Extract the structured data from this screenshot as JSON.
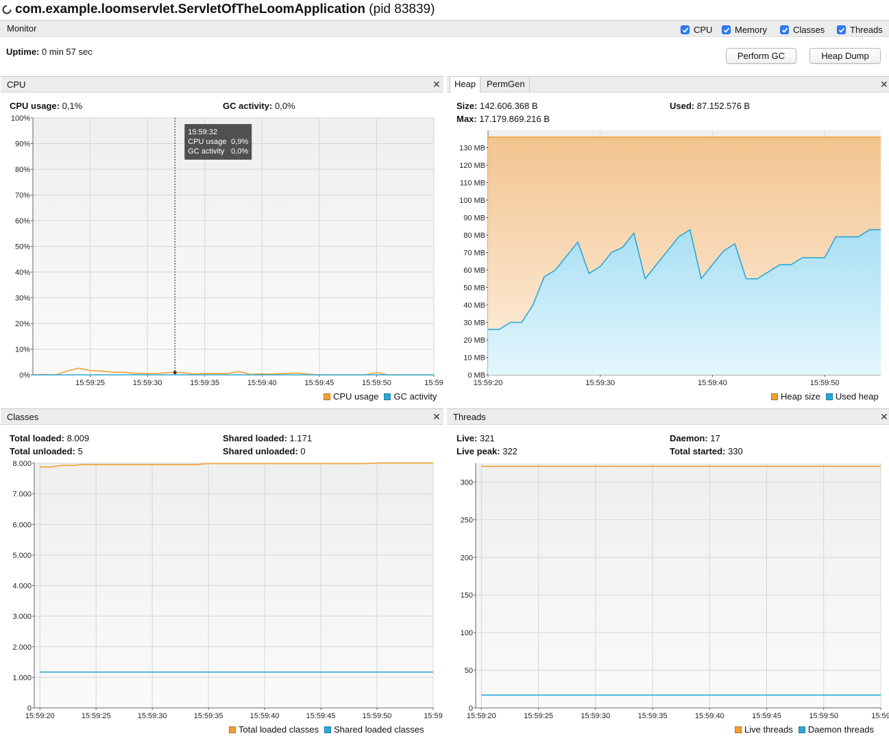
{
  "window": {
    "app_name": "com.example.loomservlet.ServletOfTheLoomApplication",
    "pid_text": "(pid 83839)"
  },
  "monitor": {
    "label": "Monitor",
    "checkboxes": [
      {
        "label": "CPU",
        "checked": true
      },
      {
        "label": "Memory",
        "checked": true
      },
      {
        "label": "Classes",
        "checked": true
      },
      {
        "label": "Threads",
        "checked": true
      }
    ],
    "uptime_label": "Uptime:",
    "uptime_value": "0 min 57 sec",
    "perform_gc": "Perform GC",
    "heap_dump": "Heap Dump"
  },
  "cpu": {
    "title": "CPU",
    "usage_label": "CPU usage:",
    "usage_value": "0,1%",
    "gc_label": "GC activity:",
    "gc_value": "0,0%",
    "tooltip": {
      "time": "15:59:32",
      "cpu_label": "CPU usage",
      "cpu_value": "0,9%",
      "gc_label": "GC activity",
      "gc_value": "0,0%"
    },
    "legend": [
      "CPU usage",
      "GC activity"
    ]
  },
  "heap": {
    "tabs": [
      "Heap",
      "PermGen"
    ],
    "size_label": "Size:",
    "size_value": "142.606.368 B",
    "used_label": "Used:",
    "used_value": "87.152.576 B",
    "max_label": "Max:",
    "max_value": "17.179.869.216 B",
    "legend": [
      "Heap size",
      "Used heap"
    ]
  },
  "classes": {
    "title": "Classes",
    "total_loaded_label": "Total loaded:",
    "total_loaded_value": "8.009",
    "shared_loaded_label": "Shared loaded:",
    "shared_loaded_value": "1.171",
    "total_unloaded_label": "Total unloaded:",
    "total_unloaded_value": "5",
    "shared_unloaded_label": "Shared unloaded:",
    "shared_unloaded_value": "0",
    "legend": [
      "Total loaded classes",
      "Shared loaded classes"
    ]
  },
  "threads": {
    "title": "Threads",
    "live_label": "Live:",
    "live_value": "321",
    "daemon_label": "Daemon:",
    "daemon_value": "17",
    "peak_label": "Live peak:",
    "peak_value": "322",
    "started_label": "Total started:",
    "started_value": "330",
    "legend": [
      "Live threads",
      "Daemon threads"
    ]
  },
  "colors": {
    "orange": "#f0a030",
    "blue": "#2aa8d8",
    "grid": "#d6d6d6",
    "plot_bg": "#f3f3f3"
  },
  "chart_data": [
    {
      "type": "line",
      "title": "CPU",
      "ylim": [
        0,
        100
      ],
      "y_ticks": [
        "0%",
        "10%",
        "20%",
        "30%",
        "40%",
        "50%",
        "60%",
        "70%",
        "80%",
        "90%",
        "100%"
      ],
      "x_ticks": [
        "15:59:25",
        "15:59:30",
        "15:59:35",
        "15:59:40",
        "15:59:45",
        "15:59:50",
        "15:59"
      ],
      "x_seconds": [
        20,
        21,
        22,
        23,
        24,
        25,
        26,
        27,
        28,
        29,
        30,
        31,
        32,
        33,
        34,
        35,
        36,
        37,
        38,
        39,
        40,
        41,
        42,
        43,
        44,
        45,
        46,
        47,
        48,
        49,
        50,
        51,
        52,
        53,
        54,
        55
      ],
      "series": [
        {
          "name": "CPU usage",
          "values": [
            0,
            0.2,
            0,
            1.5,
            2.6,
            1.6,
            1.5,
            1,
            1,
            0.5,
            0.5,
            0.6,
            0.9,
            0.9,
            0.3,
            0.5,
            0.5,
            0.5,
            1.3,
            0.2,
            0.4,
            0.3,
            0.5,
            0.7,
            0.3,
            0,
            0,
            0,
            0,
            0,
            0.9,
            0,
            0,
            0,
            0,
            0
          ]
        },
        {
          "name": "GC activity",
          "values": [
            0,
            0,
            0,
            0,
            0,
            0,
            0,
            0,
            0,
            0,
            0,
            0,
            0,
            0,
            0,
            0,
            0,
            0,
            0,
            0,
            0,
            0,
            0,
            0,
            0,
            0,
            0,
            0,
            0,
            0,
            0,
            0,
            0,
            0,
            0,
            0
          ]
        }
      ],
      "grid": true,
      "legend_position": "bottom-right"
    },
    {
      "type": "area",
      "title": "Heap",
      "ylim": [
        0,
        140
      ],
      "y_ticks": [
        "0 MB",
        "10 MB",
        "20 MB",
        "30 MB",
        "40 MB",
        "50 MB",
        "60 MB",
        "70 MB",
        "80 MB",
        "90 MB",
        "100 MB",
        "110 MB",
        "120 MB",
        "130 MB"
      ],
      "x_ticks": [
        "15:59:20",
        "15:59:30",
        "15:59:40",
        "15:59:50"
      ],
      "x_seconds": [
        20,
        21,
        22,
        23,
        24,
        25,
        26,
        27,
        28,
        29,
        30,
        31,
        32,
        33,
        34,
        35,
        36,
        37,
        38,
        39,
        40,
        41,
        42,
        43,
        44,
        45,
        46,
        47,
        48,
        49,
        50,
        51,
        52,
        53,
        54,
        55
      ],
      "series": [
        {
          "name": "Heap size",
          "values": [
            136,
            136,
            136,
            136,
            136,
            136,
            136,
            136,
            136,
            136,
            136,
            136,
            136,
            136,
            136,
            136,
            136,
            136,
            136,
            136,
            136,
            136,
            136,
            136,
            136,
            136,
            136,
            136,
            136,
            136,
            136,
            136,
            136,
            136,
            136,
            136
          ]
        },
        {
          "name": "Used heap",
          "values": [
            26,
            26,
            30,
            30,
            40,
            56,
            60,
            68,
            76,
            58,
            62,
            70,
            73,
            81,
            55,
            63,
            71,
            79,
            83,
            55,
            63,
            71,
            75,
            55,
            55,
            59,
            63,
            63,
            67,
            67,
            67,
            79,
            79,
            79,
            83,
            83
          ]
        }
      ],
      "grid": true,
      "legend_position": "bottom-right"
    },
    {
      "type": "line",
      "title": "Classes",
      "ylim": [
        0,
        8000
      ],
      "y_ticks": [
        "0",
        "1.000",
        "2.000",
        "3.000",
        "4.000",
        "5.000",
        "6.000",
        "7.000",
        "8.000"
      ],
      "x_ticks": [
        "15:59:20",
        "15:59:25",
        "15:59:30",
        "15:59:35",
        "15:59:40",
        "15:59:45",
        "15:59:50",
        "15:59"
      ],
      "x_seconds": [
        20,
        21,
        22,
        23,
        24,
        25,
        26,
        27,
        28,
        29,
        30,
        31,
        32,
        33,
        34,
        35,
        36,
        37,
        38,
        39,
        40,
        41,
        42,
        43,
        44,
        45,
        46,
        47,
        48,
        49,
        50,
        51,
        52,
        53,
        54,
        55
      ],
      "series": [
        {
          "name": "Total loaded classes",
          "values": [
            7880,
            7880,
            7930,
            7930,
            7960,
            7960,
            7960,
            7960,
            7960,
            7960,
            7960,
            7960,
            7960,
            7960,
            7960,
            7990,
            7990,
            7990,
            7990,
            7990,
            7990,
            7990,
            7990,
            7990,
            7990,
            7990,
            7990,
            7990,
            7990,
            7990,
            8009,
            8009,
            8009,
            8009,
            8009,
            8009
          ]
        },
        {
          "name": "Shared loaded classes",
          "values": [
            1171,
            1171,
            1171,
            1171,
            1171,
            1171,
            1171,
            1171,
            1171,
            1171,
            1171,
            1171,
            1171,
            1171,
            1171,
            1171,
            1171,
            1171,
            1171,
            1171,
            1171,
            1171,
            1171,
            1171,
            1171,
            1171,
            1171,
            1171,
            1171,
            1171,
            1171,
            1171,
            1171,
            1171,
            1171,
            1171
          ]
        }
      ],
      "grid": true,
      "legend_position": "bottom-right"
    },
    {
      "type": "line",
      "title": "Threads",
      "ylim": [
        0,
        325
      ],
      "y_ticks": [
        "0",
        "50",
        "100",
        "150",
        "200",
        "250",
        "300"
      ],
      "x_ticks": [
        "15:59:20",
        "15:59:25",
        "15:59:30",
        "15:59:35",
        "15:59:40",
        "15:59:45",
        "15:59:50",
        "15:59"
      ],
      "x_seconds": [
        20,
        55
      ],
      "series": [
        {
          "name": "Live threads",
          "values": [
            321,
            321
          ]
        },
        {
          "name": "Daemon threads",
          "values": [
            17,
            17
          ]
        }
      ],
      "grid": true,
      "legend_position": "bottom-right"
    }
  ]
}
